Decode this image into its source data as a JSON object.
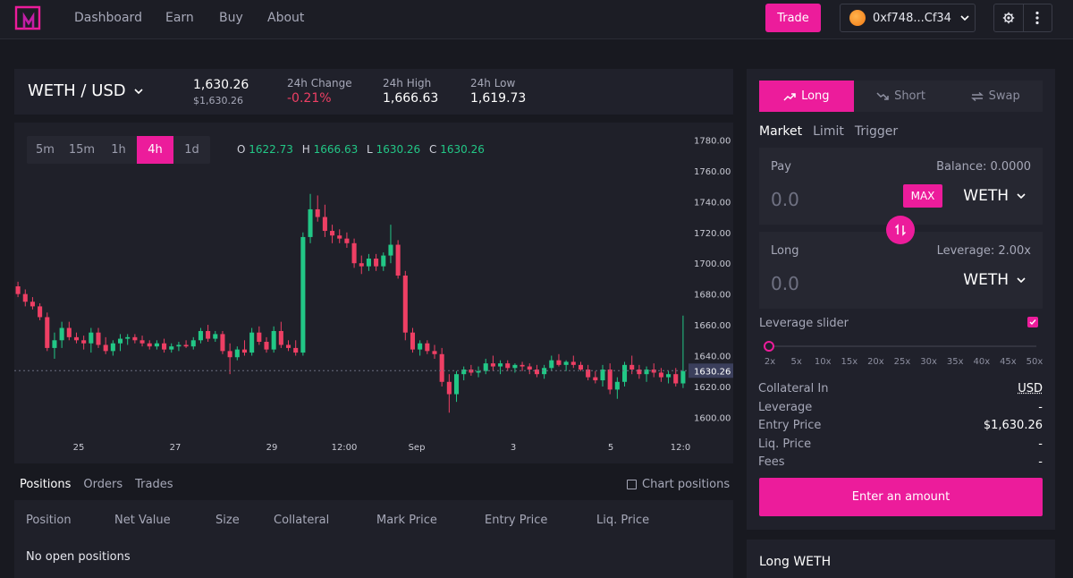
{
  "header": {
    "nav": [
      "Dashboard",
      "Earn",
      "Buy",
      "About"
    ],
    "trade_label": "Trade",
    "wallet_address": "0xf748...Cf34",
    "accent": "#ec1c9b"
  },
  "ticker": {
    "pair": "WETH / USD",
    "price": "1,630.26",
    "price_usd": "$1,630.26",
    "change_label": "24h Change",
    "change_value": "-0.21%",
    "high_label": "24h High",
    "high_value": "1,666.63",
    "low_label": "24h Low",
    "low_value": "1,619.73"
  },
  "chart": {
    "timeframes": [
      "5m",
      "15m",
      "1h",
      "4h",
      "1d"
    ],
    "active_timeframe": "4h",
    "ohlc": {
      "o_label": "O",
      "o": "1622.73",
      "h_label": "H",
      "h": "1666.63",
      "l_label": "L",
      "l": "1630.26",
      "c_label": "C",
      "c": "1630.26"
    }
  },
  "chart_data": {
    "type": "candlestick",
    "y_ticks": [
      "1780.00",
      "1760.00",
      "1740.00",
      "1720.00",
      "1700.00",
      "1680.00",
      "1660.00",
      "1640.00",
      "1620.00",
      "1600.00"
    ],
    "ylim": [
      1595,
      1782
    ],
    "x_ticks": [
      "25",
      "27",
      "29",
      "12:00",
      "Sep",
      "3",
      "5",
      "12:0"
    ],
    "last_price_label": "1630.26",
    "last_price": 1630.26,
    "up_color": "#22c786",
    "down_color": "#ee3f64",
    "candles": [
      [
        1685,
        1688,
        1678,
        1680
      ],
      [
        1680,
        1683,
        1672,
        1675
      ],
      [
        1675,
        1678,
        1670,
        1672
      ],
      [
        1672,
        1674,
        1663,
        1665
      ],
      [
        1665,
        1668,
        1643,
        1645
      ],
      [
        1645,
        1655,
        1638,
        1650
      ],
      [
        1650,
        1662,
        1645,
        1658
      ],
      [
        1658,
        1662,
        1650,
        1652
      ],
      [
        1652,
        1655,
        1648,
        1650
      ],
      [
        1650,
        1653,
        1644,
        1648
      ],
      [
        1648,
        1658,
        1642,
        1655
      ],
      [
        1655,
        1658,
        1645,
        1647
      ],
      [
        1647,
        1652,
        1641,
        1643
      ],
      [
        1643,
        1650,
        1640,
        1648
      ],
      [
        1648,
        1654,
        1643,
        1651
      ],
      [
        1651,
        1654,
        1647,
        1652
      ],
      [
        1652,
        1654,
        1648,
        1650
      ],
      [
        1650,
        1653,
        1646,
        1648
      ],
      [
        1648,
        1650,
        1644,
        1646
      ],
      [
        1646,
        1650,
        1644,
        1648
      ],
      [
        1648,
        1651,
        1642,
        1644
      ],
      [
        1644,
        1648,
        1642,
        1646
      ],
      [
        1646,
        1649,
        1643,
        1647
      ],
      [
        1647,
        1650,
        1645,
        1646
      ],
      [
        1646,
        1652,
        1644,
        1650
      ],
      [
        1650,
        1658,
        1648,
        1656
      ],
      [
        1656,
        1660,
        1649,
        1651
      ],
      [
        1651,
        1656,
        1649,
        1654
      ],
      [
        1654,
        1656,
        1641,
        1643
      ],
      [
        1643,
        1648,
        1628,
        1639
      ],
      [
        1639,
        1646,
        1637,
        1644
      ],
      [
        1644,
        1650,
        1640,
        1642
      ],
      [
        1642,
        1658,
        1640,
        1655
      ],
      [
        1655,
        1659,
        1647,
        1649
      ],
      [
        1649,
        1652,
        1642,
        1644
      ],
      [
        1644,
        1659,
        1642,
        1656
      ],
      [
        1656,
        1662,
        1645,
        1647
      ],
      [
        1647,
        1650,
        1643,
        1645
      ],
      [
        1645,
        1650,
        1640,
        1642
      ],
      [
        1642,
        1720,
        1640,
        1717
      ],
      [
        1717,
        1745,
        1713,
        1735
      ],
      [
        1735,
        1744,
        1727,
        1730
      ],
      [
        1730,
        1738,
        1717,
        1721
      ],
      [
        1721,
        1725,
        1713,
        1718
      ],
      [
        1718,
        1722,
        1713,
        1716
      ],
      [
        1716,
        1720,
        1710,
        1713
      ],
      [
        1713,
        1716,
        1697,
        1700
      ],
      [
        1700,
        1705,
        1693,
        1698
      ],
      [
        1698,
        1706,
        1695,
        1703
      ],
      [
        1703,
        1706,
        1695,
        1698
      ],
      [
        1698,
        1707,
        1695,
        1705
      ],
      [
        1705,
        1725,
        1700,
        1712
      ],
      [
        1712,
        1715,
        1690,
        1692
      ],
      [
        1692,
        1695,
        1650,
        1655
      ],
      [
        1655,
        1658,
        1642,
        1644
      ],
      [
        1644,
        1650,
        1640,
        1648
      ],
      [
        1648,
        1650,
        1641,
        1643
      ],
      [
        1643,
        1647,
        1638,
        1641
      ],
      [
        1641,
        1645,
        1620,
        1623
      ],
      [
        1623,
        1628,
        1603,
        1615
      ],
      [
        1615,
        1630,
        1610,
        1628
      ],
      [
        1628,
        1633,
        1624,
        1631
      ],
      [
        1631,
        1634,
        1627,
        1629
      ],
      [
        1629,
        1633,
        1626,
        1630
      ],
      [
        1630,
        1638,
        1628,
        1635
      ],
      [
        1635,
        1640,
        1630,
        1633
      ],
      [
        1633,
        1637,
        1628,
        1635
      ],
      [
        1635,
        1637,
        1630,
        1632
      ],
      [
        1632,
        1635,
        1629,
        1634
      ],
      [
        1634,
        1636,
        1630,
        1633
      ],
      [
        1633,
        1635,
        1628,
        1631
      ],
      [
        1631,
        1634,
        1626,
        1628
      ],
      [
        1628,
        1634,
        1625,
        1632
      ],
      [
        1632,
        1640,
        1630,
        1637
      ],
      [
        1637,
        1641,
        1633,
        1634
      ],
      [
        1634,
        1637,
        1630,
        1636
      ],
      [
        1636,
        1640,
        1632,
        1634
      ],
      [
        1634,
        1636,
        1630,
        1631
      ],
      [
        1631,
        1634,
        1624,
        1626
      ],
      [
        1626,
        1630,
        1622,
        1624
      ],
      [
        1624,
        1634,
        1620,
        1631
      ],
      [
        1631,
        1635,
        1615,
        1618
      ],
      [
        1618,
        1626,
        1612,
        1623
      ],
      [
        1623,
        1636,
        1620,
        1634
      ],
      [
        1634,
        1640,
        1628,
        1631
      ],
      [
        1631,
        1634,
        1625,
        1628
      ],
      [
        1628,
        1633,
        1623,
        1631
      ],
      [
        1631,
        1635,
        1626,
        1629
      ],
      [
        1629,
        1632,
        1623,
        1626
      ],
      [
        1626,
        1630,
        1622,
        1628
      ],
      [
        1628,
        1632,
        1620,
        1622
      ],
      [
        1622,
        1666,
        1619,
        1630
      ]
    ]
  },
  "positions": {
    "tabs": [
      "Positions",
      "Orders",
      "Trades"
    ],
    "chart_positions_label": "Chart positions",
    "columns": [
      "Position",
      "Net Value",
      "Size",
      "Collateral",
      "Mark Price",
      "Entry Price",
      "Liq. Price"
    ],
    "empty_text": "No open positions"
  },
  "panel": {
    "side_tabs": [
      "Long",
      "Short",
      "Swap"
    ],
    "order_types": [
      "Market",
      "Limit",
      "Trigger"
    ],
    "pay": {
      "label": "Pay",
      "balance": "Balance: 0.0000",
      "amount_placeholder": "0.0",
      "max_label": "MAX",
      "token": "WETH"
    },
    "long": {
      "label": "Long",
      "leverage": "Leverage: 2.00x",
      "amount_placeholder": "0.0",
      "token": "WETH"
    },
    "leverage_slider_label": "Leverage slider",
    "leverage_value": 2,
    "leverage_marks": [
      "2x",
      "5x",
      "10x",
      "15x",
      "20x",
      "25x",
      "30x",
      "35x",
      "40x",
      "45x",
      "50x"
    ],
    "info": [
      {
        "k": "Collateral In",
        "v": "USD"
      },
      {
        "k": "Leverage",
        "v": "-"
      },
      {
        "k": "Entry Price",
        "v": "$1,630.26"
      },
      {
        "k": "Liq. Price",
        "v": "-"
      },
      {
        "k": "Fees",
        "v": "-"
      }
    ],
    "cta_label": "Enter an amount",
    "section2_title": "Long WETH"
  }
}
